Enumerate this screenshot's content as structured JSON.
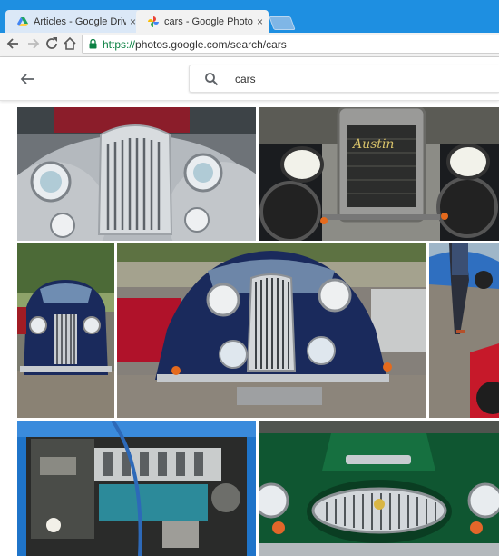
{
  "browser": {
    "tabs": [
      {
        "title": "Articles - Google Drive",
        "active": false,
        "favicon": "google-drive-icon"
      },
      {
        "title": "cars - Google Photos",
        "active": true,
        "favicon": "google-photos-icon"
      }
    ],
    "close_glyph": "×",
    "url_scheme": "https://",
    "url_rest": "photos.google.com/search/cars"
  },
  "photos": {
    "search_query": "cars",
    "results": [
      {
        "name": "photo-silver-car-grille"
      },
      {
        "name": "photo-austin-vintage-car"
      },
      {
        "name": "photo-blue-car-small"
      },
      {
        "name": "photo-blue-car-front"
      },
      {
        "name": "photo-blue-car-partial"
      },
      {
        "name": "photo-engine-bay"
      },
      {
        "name": "photo-green-austin-healey"
      }
    ]
  },
  "colors": {
    "tab_strip": "#1e8fe1",
    "secure_green": "#0b8043",
    "car_blue": "#1a2a5c",
    "car_green": "#0d4a2a",
    "car_silver": "#a8adb3"
  }
}
